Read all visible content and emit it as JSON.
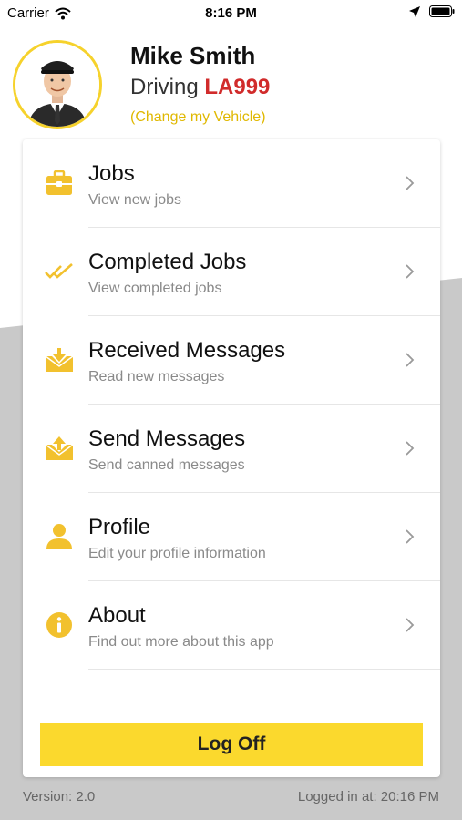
{
  "status_bar": {
    "carrier": "Carrier",
    "time": "8:16 PM",
    "icons": [
      "wifi-icon",
      "location-arrow-icon",
      "battery-icon"
    ]
  },
  "driver": {
    "name": "Mike Smith",
    "driving_prefix": "Driving",
    "vehicle": "LA999",
    "change_vehicle_link": "(Change my Vehicle)"
  },
  "menu": [
    {
      "title": "Jobs",
      "subtitle": "View new jobs",
      "icon": "briefcase-icon"
    },
    {
      "title": "Completed Jobs",
      "subtitle": "View completed jobs",
      "icon": "double-check-icon"
    },
    {
      "title": "Received Messages",
      "subtitle": "Read new messages",
      "icon": "inbox-download-icon"
    },
    {
      "title": "Send Messages",
      "subtitle": "Send canned messages",
      "icon": "inbox-upload-icon"
    },
    {
      "title": "Profile",
      "subtitle": "Edit your profile information",
      "icon": "user-icon"
    },
    {
      "title": "About",
      "subtitle": "Find out more about this app",
      "icon": "info-icon"
    }
  ],
  "logoff_label": "Log Off",
  "footer": {
    "version": "Version: 2.0",
    "logged_in": "Logged in at: 20:16 PM"
  },
  "colors": {
    "accent": "#fbd92d",
    "plate": "#d12b2b",
    "link": "#e0b800",
    "background_gray": "#c9c9c9"
  }
}
